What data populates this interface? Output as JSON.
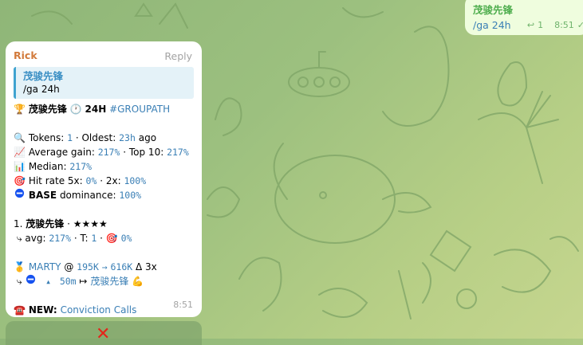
{
  "outgoing": {
    "name": "茂骏先锋",
    "command": "/ga 24h",
    "replies_count": "1",
    "time": "8:51"
  },
  "message": {
    "sender": "Rick",
    "reply_label": "Reply",
    "quote": {
      "name": "茂骏先锋",
      "text": "/ga 24h"
    },
    "header": {
      "name": "茂骏先锋",
      "period": "24H",
      "tag": "#GROUPATH"
    },
    "tokens_label": "Tokens:",
    "tokens_value": "1",
    "oldest_label": "· Oldest:",
    "oldest_value": "23h",
    "oldest_suffix": "ago",
    "avg_label": "Average gain:",
    "avg_value": "217%",
    "top10_label": "· Top 10:",
    "top10_value": "217%",
    "median_label": "Median:",
    "median_value": "217%",
    "hitrate_label": "Hit rate 5x:",
    "hitrate5_value": "0%",
    "hitrate2_label": "· 2x:",
    "hitrate2_value": "100%",
    "base_label": "BASE",
    "base_suffix": "dominance:",
    "base_value": "100%",
    "rank_item": {
      "index": "1.",
      "name": "茂骏先锋",
      "stars": "· ★★★★"
    },
    "rank_stats": {
      "avg_label": "avg:",
      "avg_value": "217%",
      "t_label": "· T:",
      "t_value": "1",
      "sep": "·",
      "hit_value": "0%"
    },
    "call": {
      "token": "MARTY",
      "at": "@",
      "from": "195K",
      "to": "616K",
      "delta": "Δ 3x"
    },
    "call_detail": {
      "time": "50m",
      "arrow": "↦",
      "caller": "茂骏先锋"
    },
    "new_label": "NEW:",
    "new_link": "Conviction Calls",
    "time": "8:51"
  },
  "icons": {
    "trophy": "trophy-icon",
    "clock": "clock-icon",
    "search": "magnifier-icon",
    "chart-up": "chart-increasing-icon",
    "bar-chart": "bar-chart-icon",
    "target": "direct-hit-icon",
    "base": "base-chain-icon",
    "medal": "gold-medal-icon",
    "muscle": "flexed-biceps-icon",
    "phone": "telephone-icon",
    "close": "cross-mark-icon"
  },
  "colors": {
    "sender": "#d27a3b",
    "link": "#3a7fb5",
    "outgoing_name": "#4fae4e",
    "outgoing_bubble": "#effdde",
    "quote_bar": "#3fa3d0"
  }
}
